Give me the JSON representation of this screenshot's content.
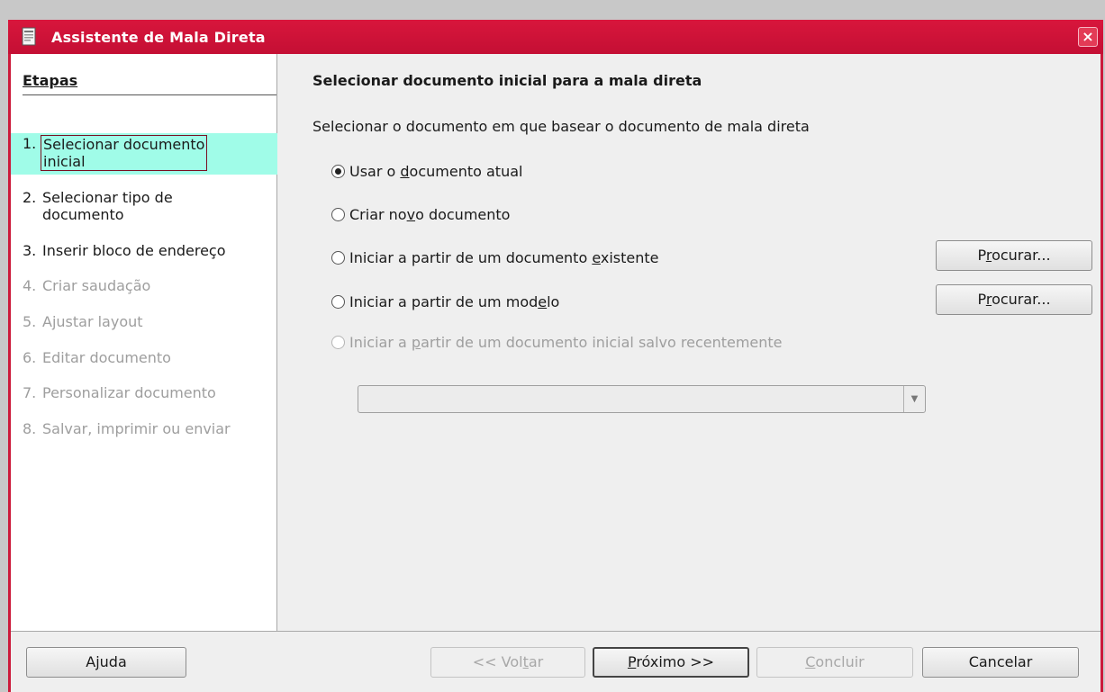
{
  "window": {
    "title": "Assistente de Mala Direta",
    "close_label": "×"
  },
  "sidebar": {
    "heading": "Etapas",
    "steps": [
      {
        "num": "1.",
        "line1": "Selecionar documento",
        "line2": "inicial",
        "state": "active"
      },
      {
        "num": "2.",
        "line1": "Selecionar tipo de",
        "line2": "documento",
        "state": "enabled"
      },
      {
        "num": "3.",
        "line1": "Inserir bloco de endereço",
        "state": "enabled"
      },
      {
        "num": "4.",
        "line1": "Criar saudação",
        "state": "disabled"
      },
      {
        "num": "5.",
        "line1": "Ajustar layout",
        "state": "disabled"
      },
      {
        "num": "6.",
        "line1": "Editar documento",
        "state": "disabled"
      },
      {
        "num": "7.",
        "line1": "Personalizar documento",
        "state": "disabled"
      },
      {
        "num": "8.",
        "line1": "Salvar, imprimir ou enviar",
        "state": "disabled"
      }
    ]
  },
  "content": {
    "title": "Selecionar documento inicial para a mala direta",
    "description": "Selecionar o documento em que basear o documento de mala direta",
    "options": [
      {
        "pre": "Usar o ",
        "acc": "d",
        "post": "ocumento atual",
        "checked": true,
        "disabled": false
      },
      {
        "pre": "Criar no",
        "acc": "v",
        "post": "o documento",
        "checked": false,
        "disabled": false
      },
      {
        "pre": "Iniciar a partir de um documento ",
        "acc": "e",
        "post": "xistente",
        "checked": false,
        "disabled": false
      },
      {
        "pre": "Iniciar a partir de um mod",
        "acc": "e",
        "post": "lo",
        "checked": false,
        "disabled": false
      },
      {
        "pre": "Iniciar a ",
        "acc": "p",
        "post": "artir de um documento inicial salvo recentemente",
        "checked": false,
        "disabled": true
      }
    ],
    "browse_button_1": {
      "pre": "P",
      "acc": "r",
      "post": "ocurar..."
    },
    "browse_button_2": {
      "pre": "P",
      "acc": "r",
      "post": "ocurar..."
    },
    "recent_combo": {
      "value": "",
      "arrow": "▼"
    }
  },
  "footer": {
    "help": {
      "pre": "A",
      "acc": "j",
      "post": "uda"
    },
    "back": {
      "pre": "<< Vol",
      "acc": "t",
      "post": "ar"
    },
    "next": {
      "pre": "",
      "acc": "P",
      "post": "róximo >>"
    },
    "finish": {
      "pre": "",
      "acc": "C",
      "post": "oncluir"
    },
    "cancel": {
      "label": "Cancelar"
    }
  }
}
